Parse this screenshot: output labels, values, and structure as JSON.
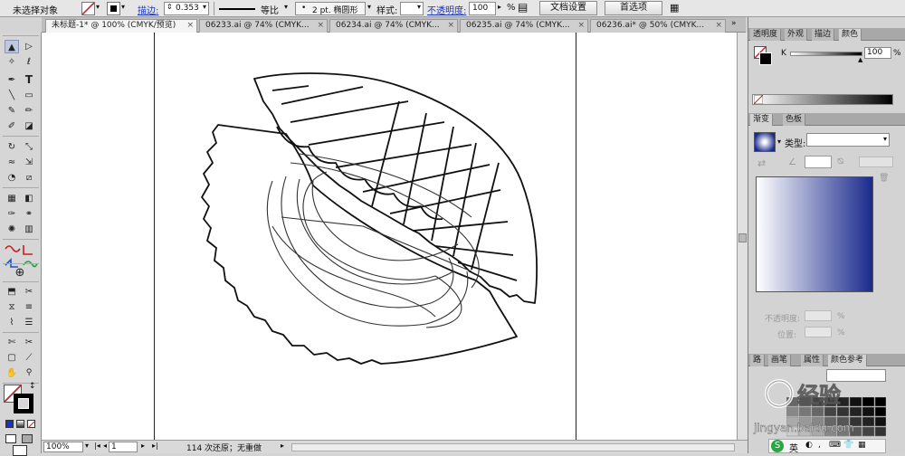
{
  "control_bar": {
    "selection": "未选择对象",
    "stroke_label": "描边:",
    "stroke_value": "0.353",
    "profile_label": "等比",
    "brush_label": "2 pt. 椭圆形",
    "style_label": "样式:",
    "opacity_label": "不透明度:",
    "opacity_value": "100",
    "opacity_unit": "%",
    "doc_setup_button": "文档设置",
    "preferences_button": "首选项"
  },
  "tabs": [
    {
      "label": "未标题-1* @ 100% (CMYK/预览)"
    },
    {
      "label": "06233.ai @ 74% (CMYK..."
    },
    {
      "label": "06234.ai @ 74% (CMYK..."
    },
    {
      "label": "06235.ai @ 74% (CMYK..."
    },
    {
      "label": "06236.ai* @ 50% (CMYK..."
    }
  ],
  "tab_close": "×",
  "tools": {
    "select": "▲",
    "direct": "▷",
    "magic": "✧",
    "lasso": "ℓ",
    "pen": "✒",
    "type": "T",
    "line": "╲",
    "rect": "▭",
    "brush": "✎",
    "pencil": "✏",
    "blob": "✐",
    "eraser": "◪",
    "rotate": "↻",
    "scale": "⤡",
    "warp": "≈",
    "free": "⇲",
    "shape": "◔",
    "persp": "⧄",
    "mesh": "▦",
    "gradient": "◧",
    "eyedrop": "✑",
    "blend": "⚭",
    "symbol": "✺",
    "graph": "▥",
    "artboard": "⬒",
    "slice": "✂",
    "hand": "✋",
    "zoom": "🔍"
  },
  "status": {
    "zoom": "100%",
    "page": "1",
    "message": "114 次还原；无重做"
  },
  "colors": {
    "stroke_red": "#d21f1f",
    "gradient_start": "#ffffff",
    "gradient_end": "#1a2a8c",
    "accent": "#1a35b8"
  },
  "panels": {
    "top_tabs": [
      "透明度",
      "外观",
      "描边",
      "颜色"
    ],
    "k_label": "K",
    "k_value": "100",
    "k_unit": "%",
    "gradient_tabs": [
      "渐变",
      "色板"
    ],
    "type_label": "类型:",
    "opacity_label": "不透明度:",
    "location_label": "位置:",
    "percent": "%",
    "bottom_tabs": [
      "路",
      "画笔",
      "属性",
      "颜色参考"
    ]
  },
  "watermark": {
    "text": "Baidu 经验",
    "url": "jingyan.baidu.com"
  },
  "ime_label": "英"
}
